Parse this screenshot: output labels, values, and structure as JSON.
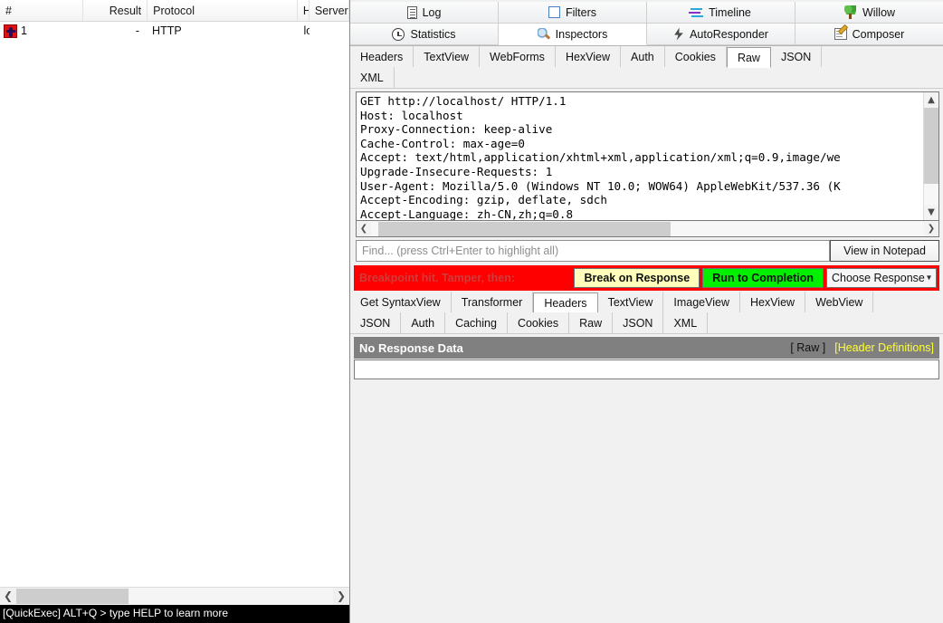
{
  "sessions": {
    "columns": [
      "#",
      "Result",
      "Protocol",
      "Host",
      "Server"
    ],
    "rows": [
      {
        "num": "1",
        "result": "-",
        "protocol": "HTTP",
        "host": "localhost",
        "server": "",
        "icon": "breakpoint-icon"
      }
    ]
  },
  "status_bar": {
    "quick_exec": "[QuickExec] ALT+Q > type HELP to learn more"
  },
  "icon_tabs": {
    "row1": [
      {
        "label": "Log",
        "icon": "log-icon",
        "selected": false
      },
      {
        "label": "Filters",
        "icon": "filters-icon",
        "selected": false
      },
      {
        "label": "Timeline",
        "icon": "timeline-icon",
        "selected": false
      },
      {
        "label": "Willow",
        "icon": "willow-icon",
        "selected": false
      }
    ],
    "row2": [
      {
        "label": "Statistics",
        "icon": "statistics-icon",
        "selected": false
      },
      {
        "label": "Inspectors",
        "icon": "inspectors-icon",
        "selected": true
      },
      {
        "label": "AutoResponder",
        "icon": "autoresponder-icon",
        "selected": false
      },
      {
        "label": "Composer",
        "icon": "composer-icon",
        "selected": false
      }
    ]
  },
  "request_tabs": {
    "row1": [
      "Headers",
      "TextView",
      "WebForms",
      "HexView",
      "Auth",
      "Cookies",
      "Raw",
      "JSON"
    ],
    "row2": [
      "XML"
    ],
    "selected": "Raw"
  },
  "request": {
    "raw": "GET http://localhost/ HTTP/1.1\nHost: localhost\nProxy-Connection: keep-alive\nCache-Control: max-age=0\nAccept: text/html,application/xhtml+xml,application/xml;q=0.9,image/we\nUpgrade-Insecure-Requests: 1\nUser-Agent: Mozilla/5.0 (Windows NT 10.0; WOW64) AppleWebKit/537.36 (K\nAccept-Encoding: gzip, deflate, sdch\nAccept-Language: zh-CN,zh;q=0.8"
  },
  "find": {
    "value": "",
    "placeholder": "Find... (press Ctrl+Enter to highlight all)",
    "notepad_label": "View in Notepad"
  },
  "breakpoint": {
    "message": "Breakpoint hit. Tamper, then:",
    "break_on_response": "Break on Response",
    "run_to_completion": "Run to Completion",
    "choose_response": "Choose Response",
    "bar_color": "#ff0000",
    "yellow_color": "#ffffbb",
    "green_color": "#00f000"
  },
  "response_tabs": {
    "row1": [
      "Get SyntaxView",
      "Transformer",
      "Headers",
      "TextView",
      "ImageView",
      "HexView",
      "WebView"
    ],
    "row2": [
      "JSON",
      "Auth",
      "Caching",
      "Cookies",
      "Raw",
      "JSON",
      "XML"
    ],
    "selected": "Headers"
  },
  "response": {
    "title": "No Response Data",
    "raw_link": "[ Raw ]",
    "header_definitions_link": "[Header Definitions]",
    "field_value": ""
  }
}
